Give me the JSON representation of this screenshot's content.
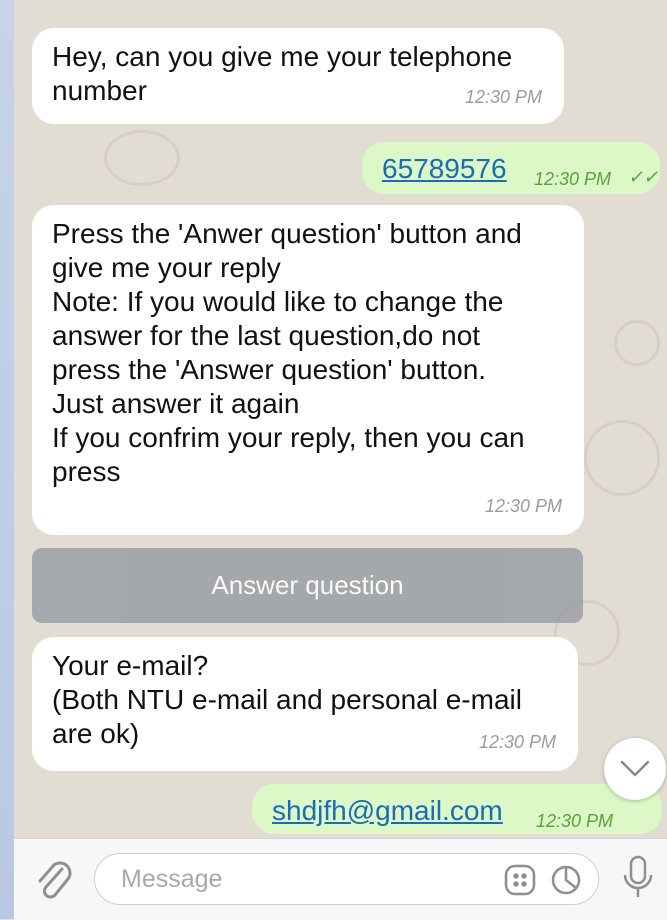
{
  "messages": [
    {
      "text": "Hey, can you give me your telephone number",
      "time": "12:30 PM"
    },
    {
      "text": "65789576",
      "time": "12:30 PM"
    },
    {
      "lines": [
        "Press the 'Anwer question' button and",
        "give me your reply",
        "Note: If you would like to change the",
        "answer for the last question,do not",
        "press the 'Answer question' button.",
        "Just answer it again",
        "If you confrim your reply, then you can",
        "press"
      ],
      "time": "12:30 PM"
    },
    {
      "lines": [
        "Your e-mail?",
        "(Both NTU e-mail and personal e-mail",
        "are ok)"
      ],
      "time": "12:30 PM"
    },
    {
      "text": "shdjfh@gmail.com",
      "time": "12:30 PM"
    }
  ],
  "keyboard_button": {
    "label": "Answer question"
  },
  "composer": {
    "placeholder": "Message"
  },
  "icons": [
    "paperclip-icon",
    "sticker-icon",
    "clock-icon",
    "microphone-icon",
    "chevron-down-icon",
    "double-check-icon"
  ],
  "colors": {
    "incoming": "#ffffff",
    "outgoing": "#dcf8c6",
    "link": "#1a6bb8",
    "button": "#9a9fa5"
  }
}
